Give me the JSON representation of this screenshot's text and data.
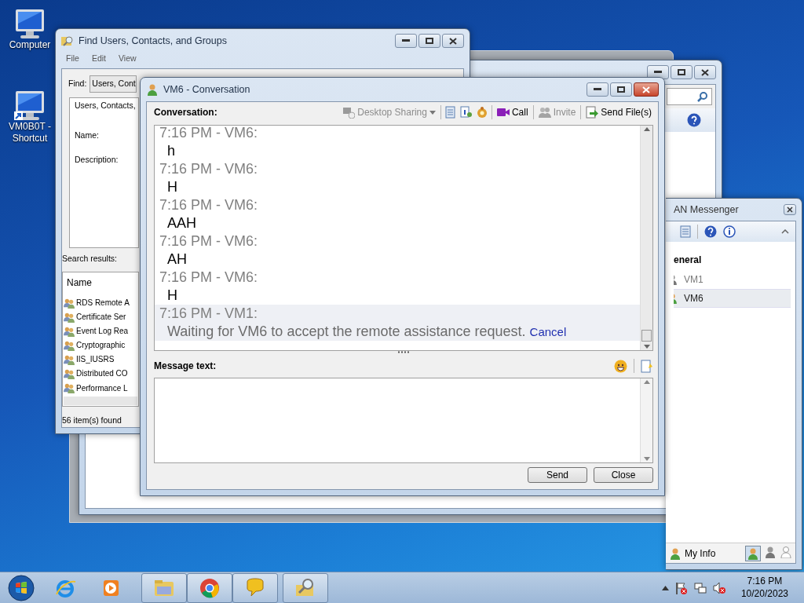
{
  "desktop_icons": [
    {
      "label": "Computer",
      "kind": "computer"
    },
    {
      "label": "VM0B0T - Shortcut",
      "kind": "shortcut"
    }
  ],
  "find_window": {
    "title": "Find Users, Contacts, and Groups",
    "menu": [
      "File",
      "Edit",
      "View"
    ],
    "find_label": "Find:",
    "find_value": "Users, Cont",
    "tab": "Users, Contacts,",
    "fields": [
      "Name:",
      "Description:"
    ],
    "results_label": "Search results:",
    "column": "Name",
    "results": [
      "RDS Remote A",
      "Certificate Ser",
      "Event Log Rea",
      "Cryptographic",
      "IIS_IUSRS",
      "Distributed CO",
      "Performance L"
    ],
    "status": "56 item(s) found"
  },
  "conversation": {
    "title": "VM6 - Conversation",
    "label": "Conversation:",
    "toolbar": [
      {
        "kind": "button",
        "label": "Desktop Sharing",
        "disabled": true,
        "dropdown": true
      },
      {
        "kind": "separator"
      },
      {
        "kind": "icon"
      },
      {
        "kind": "icon"
      },
      {
        "kind": "icon"
      },
      {
        "kind": "separator"
      },
      {
        "kind": "button",
        "label": "Call",
        "disabled": false,
        "dropdown": false
      },
      {
        "kind": "separator"
      },
      {
        "kind": "button",
        "label": "Invite",
        "disabled": true,
        "dropdown": false
      },
      {
        "kind": "separator"
      },
      {
        "kind": "button",
        "label": "Send File(s)",
        "disabled": false,
        "dropdown": false
      }
    ],
    "messages": [
      {
        "kind": "message",
        "time": "7:16 PM - VM6:",
        "text": "h"
      },
      {
        "kind": "message",
        "time": "7:16 PM - VM6:",
        "text": "H"
      },
      {
        "kind": "message",
        "time": "7:16 PM - VM6:",
        "text": "AAH"
      },
      {
        "kind": "message",
        "time": "7:16 PM - VM6:",
        "text": "AH"
      },
      {
        "kind": "message",
        "time": "7:16 PM - VM6:",
        "text": "H"
      },
      {
        "kind": "status",
        "time": "7:16 PM - VM1:",
        "text": "Waiting for VM6 to accept the remote assistance request.",
        "link": "Cancel"
      }
    ],
    "message_label": "Message text:",
    "buttons": [
      "Send",
      "Close"
    ]
  },
  "messenger": {
    "title": "AN Messenger",
    "group": "eneral",
    "contacts": [
      {
        "name": "VM1",
        "offline": true,
        "selected": false
      },
      {
        "name": "VM6",
        "offline": false,
        "selected": true
      }
    ],
    "my_info": "My Info"
  },
  "taskbar": {
    "time": "7:16 PM",
    "date": "10/20/2023"
  }
}
